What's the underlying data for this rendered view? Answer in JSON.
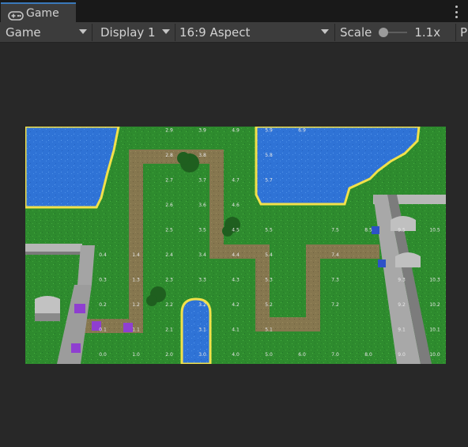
{
  "window": {
    "tab_title": "Game",
    "tab_icon": "gamepad-icon",
    "menu_icon": "kebab-menu-icon"
  },
  "toolbar": {
    "mode": "Game",
    "display": "Display 1",
    "aspect": "16:9 Aspect",
    "scale_label": "Scale",
    "scale_value": "1.1x",
    "scale_fraction": 0.0,
    "truncated_label": "P"
  },
  "game_view": {
    "grid_labels": [
      "0.0",
      "1.0",
      "2.0",
      "3.0",
      "4.0",
      "5.0",
      "6.0",
      "7.0",
      "8.0",
      "9.0",
      "10.0",
      "0.1",
      "1.1",
      "2.1",
      "3.1",
      "4.1",
      "5.1",
      "9.1",
      "10.1",
      "0.2",
      "1.2",
      "2.2",
      "3.2",
      "4.2",
      "5.2",
      "7.2",
      "9.2",
      "10.2",
      "0.3",
      "1.3",
      "2.3",
      "3.3",
      "4.3",
      "5.3",
      "7.3",
      "9.3",
      "10.3",
      "0.4",
      "1.4",
      "2.4",
      "3.4",
      "4.4",
      "5.4",
      "7.4",
      "2.5",
      "3.5",
      "4.5",
      "5.5",
      "7.5",
      "8.5",
      "9.5",
      "10.5",
      "2.6",
      "3.6",
      "4.6",
      "2.7",
      "3.7",
      "4.7",
      "5.7",
      "2.8",
      "3.8",
      "5.8",
      "2.9",
      "3.9",
      "4.9",
      "5.9",
      "6.9"
    ],
    "colors": {
      "grass": "#2e8b2e",
      "water": "#2f73d6",
      "shore": "#f2e14a",
      "path": "#8a7a52",
      "wall": "#9a9a9a",
      "tower": "#8f3fd0"
    }
  }
}
